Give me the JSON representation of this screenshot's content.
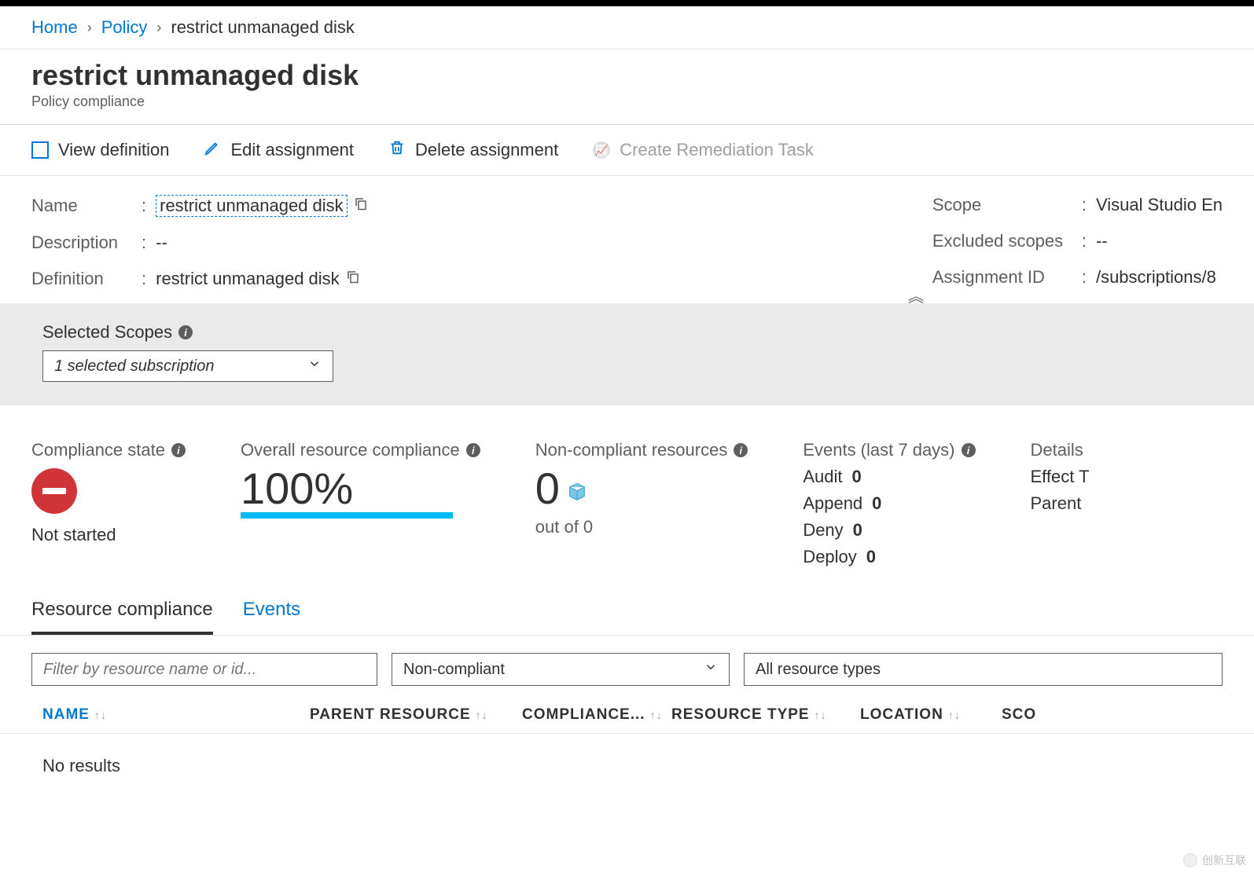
{
  "breadcrumb": {
    "home": "Home",
    "policy": "Policy",
    "current": "restrict unmanaged disk"
  },
  "header": {
    "title": "restrict unmanaged disk",
    "subtitle": "Policy compliance"
  },
  "toolbar": {
    "view_def": "View definition",
    "edit": "Edit assignment",
    "delete": "Delete assignment",
    "remediation": "Create Remediation Task"
  },
  "meta": {
    "name_label": "Name",
    "name_value": "restrict unmanaged disk",
    "desc_label": "Description",
    "desc_value": "--",
    "def_label": "Definition",
    "def_value": "restrict unmanaged disk",
    "scope_label": "Scope",
    "scope_value": "Visual Studio En",
    "excluded_label": "Excluded scopes",
    "excluded_value": "--",
    "assign_label": "Assignment ID",
    "assign_value": "/subscriptions/8"
  },
  "scopes": {
    "label": "Selected Scopes",
    "dropdown": "1 selected subscription"
  },
  "stats": {
    "compliance_state_label": "Compliance state",
    "compliance_state_text": "Not started",
    "overall_label": "Overall resource compliance",
    "overall_value": "100%",
    "noncompliant_label": "Non-compliant resources",
    "noncompliant_value": "0",
    "noncompliant_sub": "out of 0",
    "events_label": "Events (last 7 days)",
    "events": {
      "audit_label": "Audit",
      "audit_val": "0",
      "append_label": "Append",
      "append_val": "0",
      "deny_label": "Deny",
      "deny_val": "0",
      "deploy_label": "Deploy",
      "deploy_val": "0"
    },
    "details_label": "Details",
    "effect_label": "Effect T",
    "parent_label": "Parent"
  },
  "tabs": {
    "resource": "Resource compliance",
    "events": "Events"
  },
  "filters": {
    "placeholder": "Filter by resource name or id...",
    "compliance_dd": "Non-compliant",
    "type_dd": "All resource types"
  },
  "table": {
    "name": "NAME",
    "parent": "PARENT RESOURCE",
    "compliance": "COMPLIANCE...",
    "rtype": "RESOURCE TYPE",
    "location": "LOCATION",
    "scope": "SCO",
    "no_results": "No results"
  },
  "watermark": "创新互联"
}
